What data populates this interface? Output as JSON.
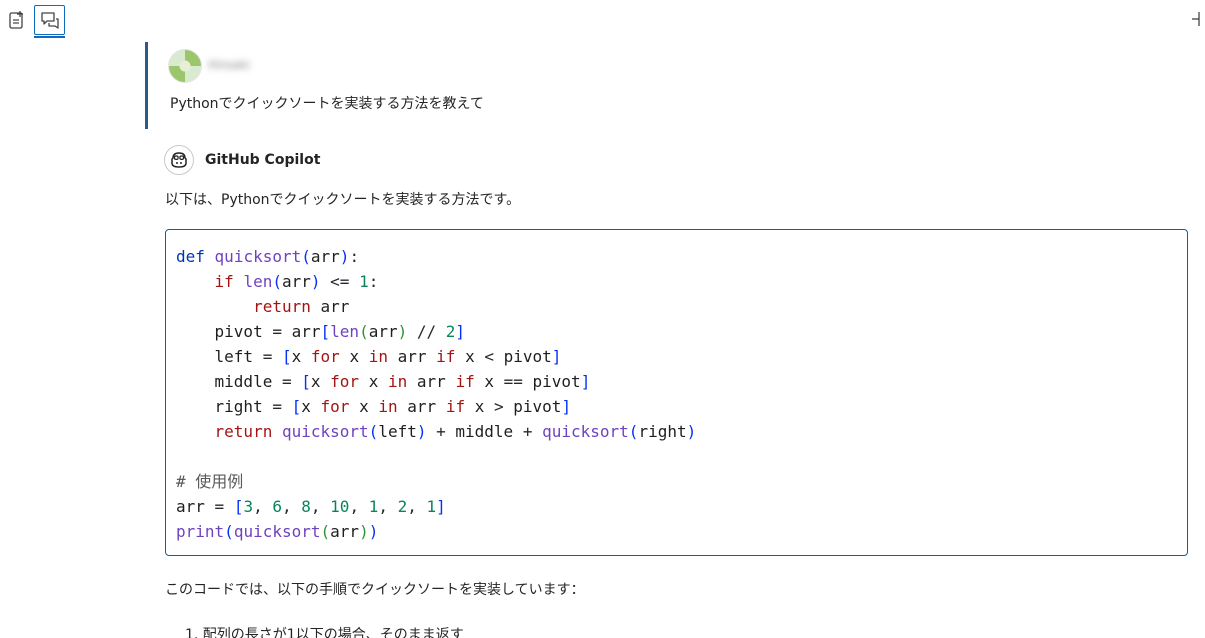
{
  "toolbar": {
    "new_chat_icon": "new-chat-icon",
    "chat_icon": "chat-icon",
    "pin_icon": "pin-icon",
    "accent": "#0f6cbd"
  },
  "conversation": {
    "user": {
      "name": "Hiroaki",
      "message": "Pythonでクイックソートを実装する方法を教えて"
    },
    "assistant": {
      "name": "GitHub Copilot",
      "intro": "以下は、Pythonでクイックソートを実装する方法です。",
      "code_lines": [
        "def quicksort(arr):",
        "    if len(arr) <= 1:",
        "        return arr",
        "    pivot = arr[len(arr) // 2]",
        "    left = [x for x in arr if x < pivot]",
        "    middle = [x for x in arr if x == pivot]",
        "    right = [x for x in arr if x > pivot]",
        "    return quicksort(left) + middle + quicksort(right)",
        "",
        "# 使用例",
        "arr = [3, 6, 8, 10, 1, 2, 1]",
        "print(quicksort(arr))"
      ],
      "after_code": "このコードでは、以下の手順でクイックソートを実装しています：",
      "steps": [
        "1. 配列の長さが1以下の場合、そのまま返す"
      ]
    }
  }
}
